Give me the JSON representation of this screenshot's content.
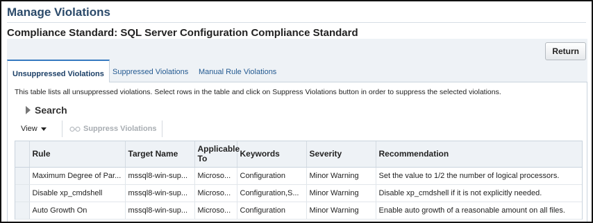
{
  "page": {
    "title": "Manage Violations",
    "subtitle": "Compliance Standard: SQL Server Configuration Compliance Standard",
    "return_label": "Return"
  },
  "tabs": [
    {
      "label": "Unsuppressed Violations",
      "active": true
    },
    {
      "label": "Suppressed Violations",
      "active": false
    },
    {
      "label": "Manual Rule Violations",
      "active": false
    }
  ],
  "instructions": "This table lists all unsuppressed violations. Select rows in the table and click on Suppress Violations button in order to suppress the selected violations.",
  "search": {
    "label": "Search"
  },
  "toolbar": {
    "view_label": "View",
    "suppress_label": "Suppress Violations",
    "suppress_icon": "glasses-icon"
  },
  "table": {
    "columns": [
      "Rule",
      "Target Name",
      "Applicable To",
      "Keywords",
      "Severity",
      "Recommendation"
    ],
    "rows": [
      {
        "rule": "Maximum Degree of Par...",
        "target": "mssql8-win-sup...",
        "applicable": "Microso...",
        "keywords": "Configuration",
        "severity": "Minor Warning",
        "recommendation": "Set the value to 1/2 the number of logical processors."
      },
      {
        "rule": "Disable xp_cmdshell",
        "target": "mssql8-win-sup...",
        "applicable": "Microso...",
        "keywords": "Configuration,S...",
        "severity": "Minor Warning",
        "recommendation": "Disable xp_cmdshell if it is not explicitly needed."
      },
      {
        "rule": "Auto Growth On",
        "target": "mssql8-win-sup...",
        "applicable": "Microso...",
        "keywords": "Configuration",
        "severity": "Minor Warning",
        "recommendation": "Enable auto growth of a reasonable amount on all files."
      }
    ]
  }
}
